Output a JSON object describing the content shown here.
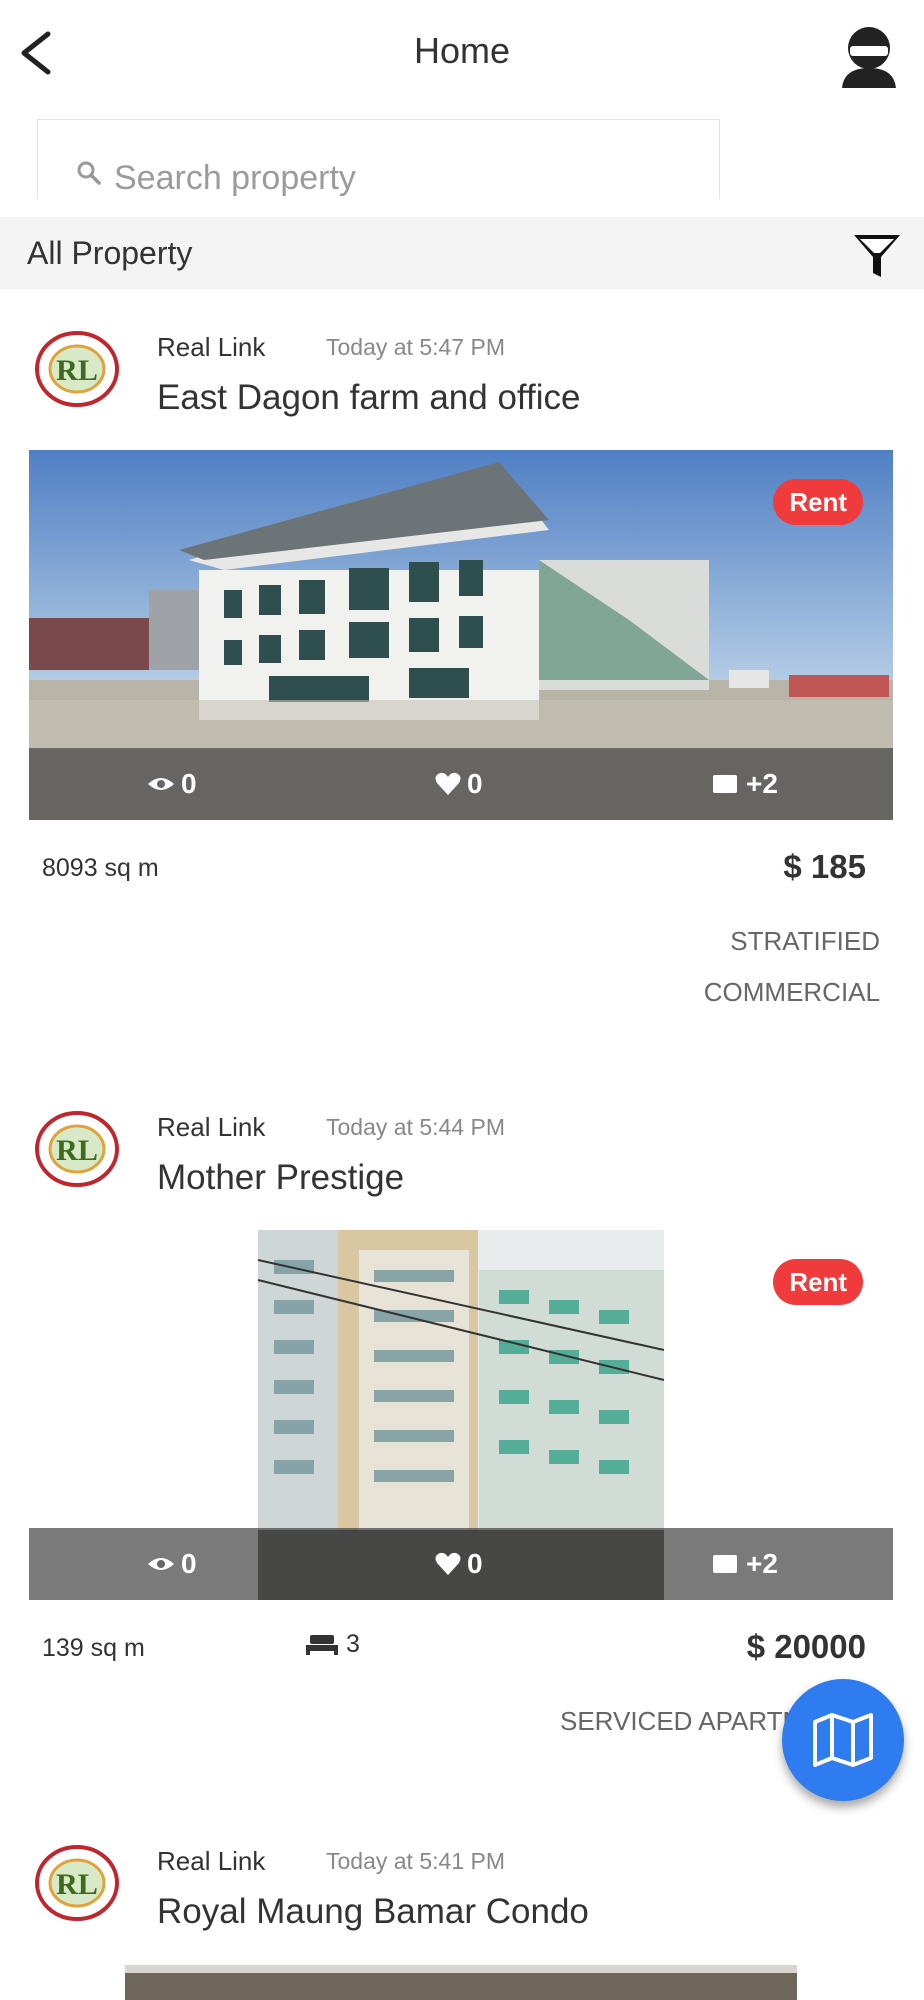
{
  "header": {
    "title": "Home"
  },
  "search": {
    "placeholder": "Search property"
  },
  "filter": {
    "label": "All Property"
  },
  "listings": [
    {
      "agent": "Real Link",
      "time": "Today at 5:47 PM",
      "title": "East Dagon farm and office",
      "badge": "Rent",
      "views": "0",
      "likes": "0",
      "photos": "+2",
      "area": "8093 sq m",
      "price": "$ 185",
      "type_line1": "STRATIFIED",
      "type_line2": "COMMERCIAL"
    },
    {
      "agent": "Real Link",
      "time": "Today at 5:44 PM",
      "title": "Mother Prestige",
      "badge": "Rent",
      "views": "0",
      "likes": "0",
      "photos": "+2",
      "area": "139 sq m",
      "bedrooms": "3",
      "price": "$ 20000",
      "type_line1": "SERVICED APARTMENT"
    },
    {
      "agent": "Real Link",
      "time": "Today at 5:41 PM",
      "title": "Royal Maung Bamar Condo"
    }
  ],
  "avatar_text": "RL",
  "colors": {
    "badge": "#ef3b3b",
    "fab": "#2f7cf0",
    "filter_bar": "#f4f4f4"
  },
  "icons": [
    "back-chevron-icon",
    "user-profile-icon",
    "search-icon",
    "filter-funnel-icon",
    "eye-icon",
    "heart-icon",
    "photos-icon",
    "bed-icon",
    "map-icon"
  ]
}
